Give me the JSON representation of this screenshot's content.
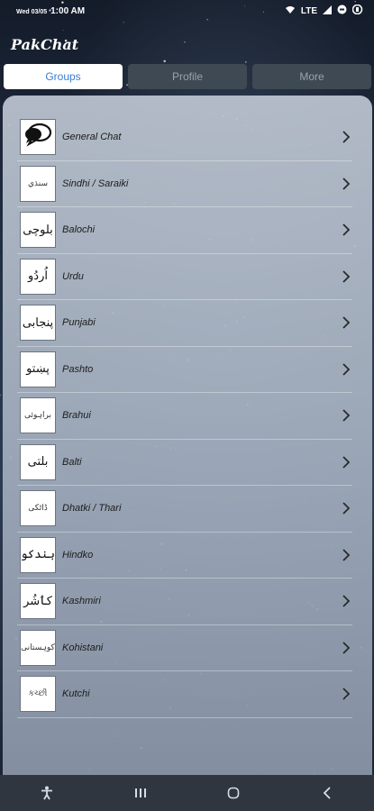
{
  "status": {
    "date": "Wed 03/05",
    "time": "1:00 AM",
    "network": "LTE"
  },
  "app": {
    "title": "PakChat"
  },
  "tabs": [
    {
      "label": "Groups",
      "active": true
    },
    {
      "label": "Profile",
      "active": false
    },
    {
      "label": "More",
      "active": false
    }
  ],
  "groups": [
    {
      "label": "General Chat",
      "thumb": "",
      "icon": "chat-bubbles-icon"
    },
    {
      "label": "Sindhi / Saraiki",
      "thumb": "سنڌي",
      "small": true
    },
    {
      "label": "Balochi",
      "thumb": "بلوچی"
    },
    {
      "label": "Urdu",
      "thumb": "اُردُو"
    },
    {
      "label": "Punjabi",
      "thumb": "پنجابی"
    },
    {
      "label": "Pashto",
      "thumb": "پښتو"
    },
    {
      "label": "Brahui",
      "thumb": "براہوئی",
      "small": true
    },
    {
      "label": "Balti",
      "thumb": "بلتی"
    },
    {
      "label": "Dhatki / Thari",
      "thumb": "ڈاٹکی",
      "small": true
    },
    {
      "label": "Hindko",
      "thumb": "ہندکو"
    },
    {
      "label": "Kashmiri",
      "thumb": "کٲشُر"
    },
    {
      "label": "Kohistani",
      "thumb": "کوہستانی",
      "small": true
    },
    {
      "label": "Kutchi",
      "thumb": "કચ્છી",
      "small": true
    }
  ],
  "nav": {
    "items": [
      "accessibility-icon",
      "recent-apps-icon",
      "home-icon",
      "back-icon"
    ]
  },
  "colors": {
    "tab_active_bg": "#ffffff",
    "tab_active_text": "#3a7bd5",
    "tab_inactive_bg": "#3f4953",
    "navbar_bg": "#2f3640"
  }
}
